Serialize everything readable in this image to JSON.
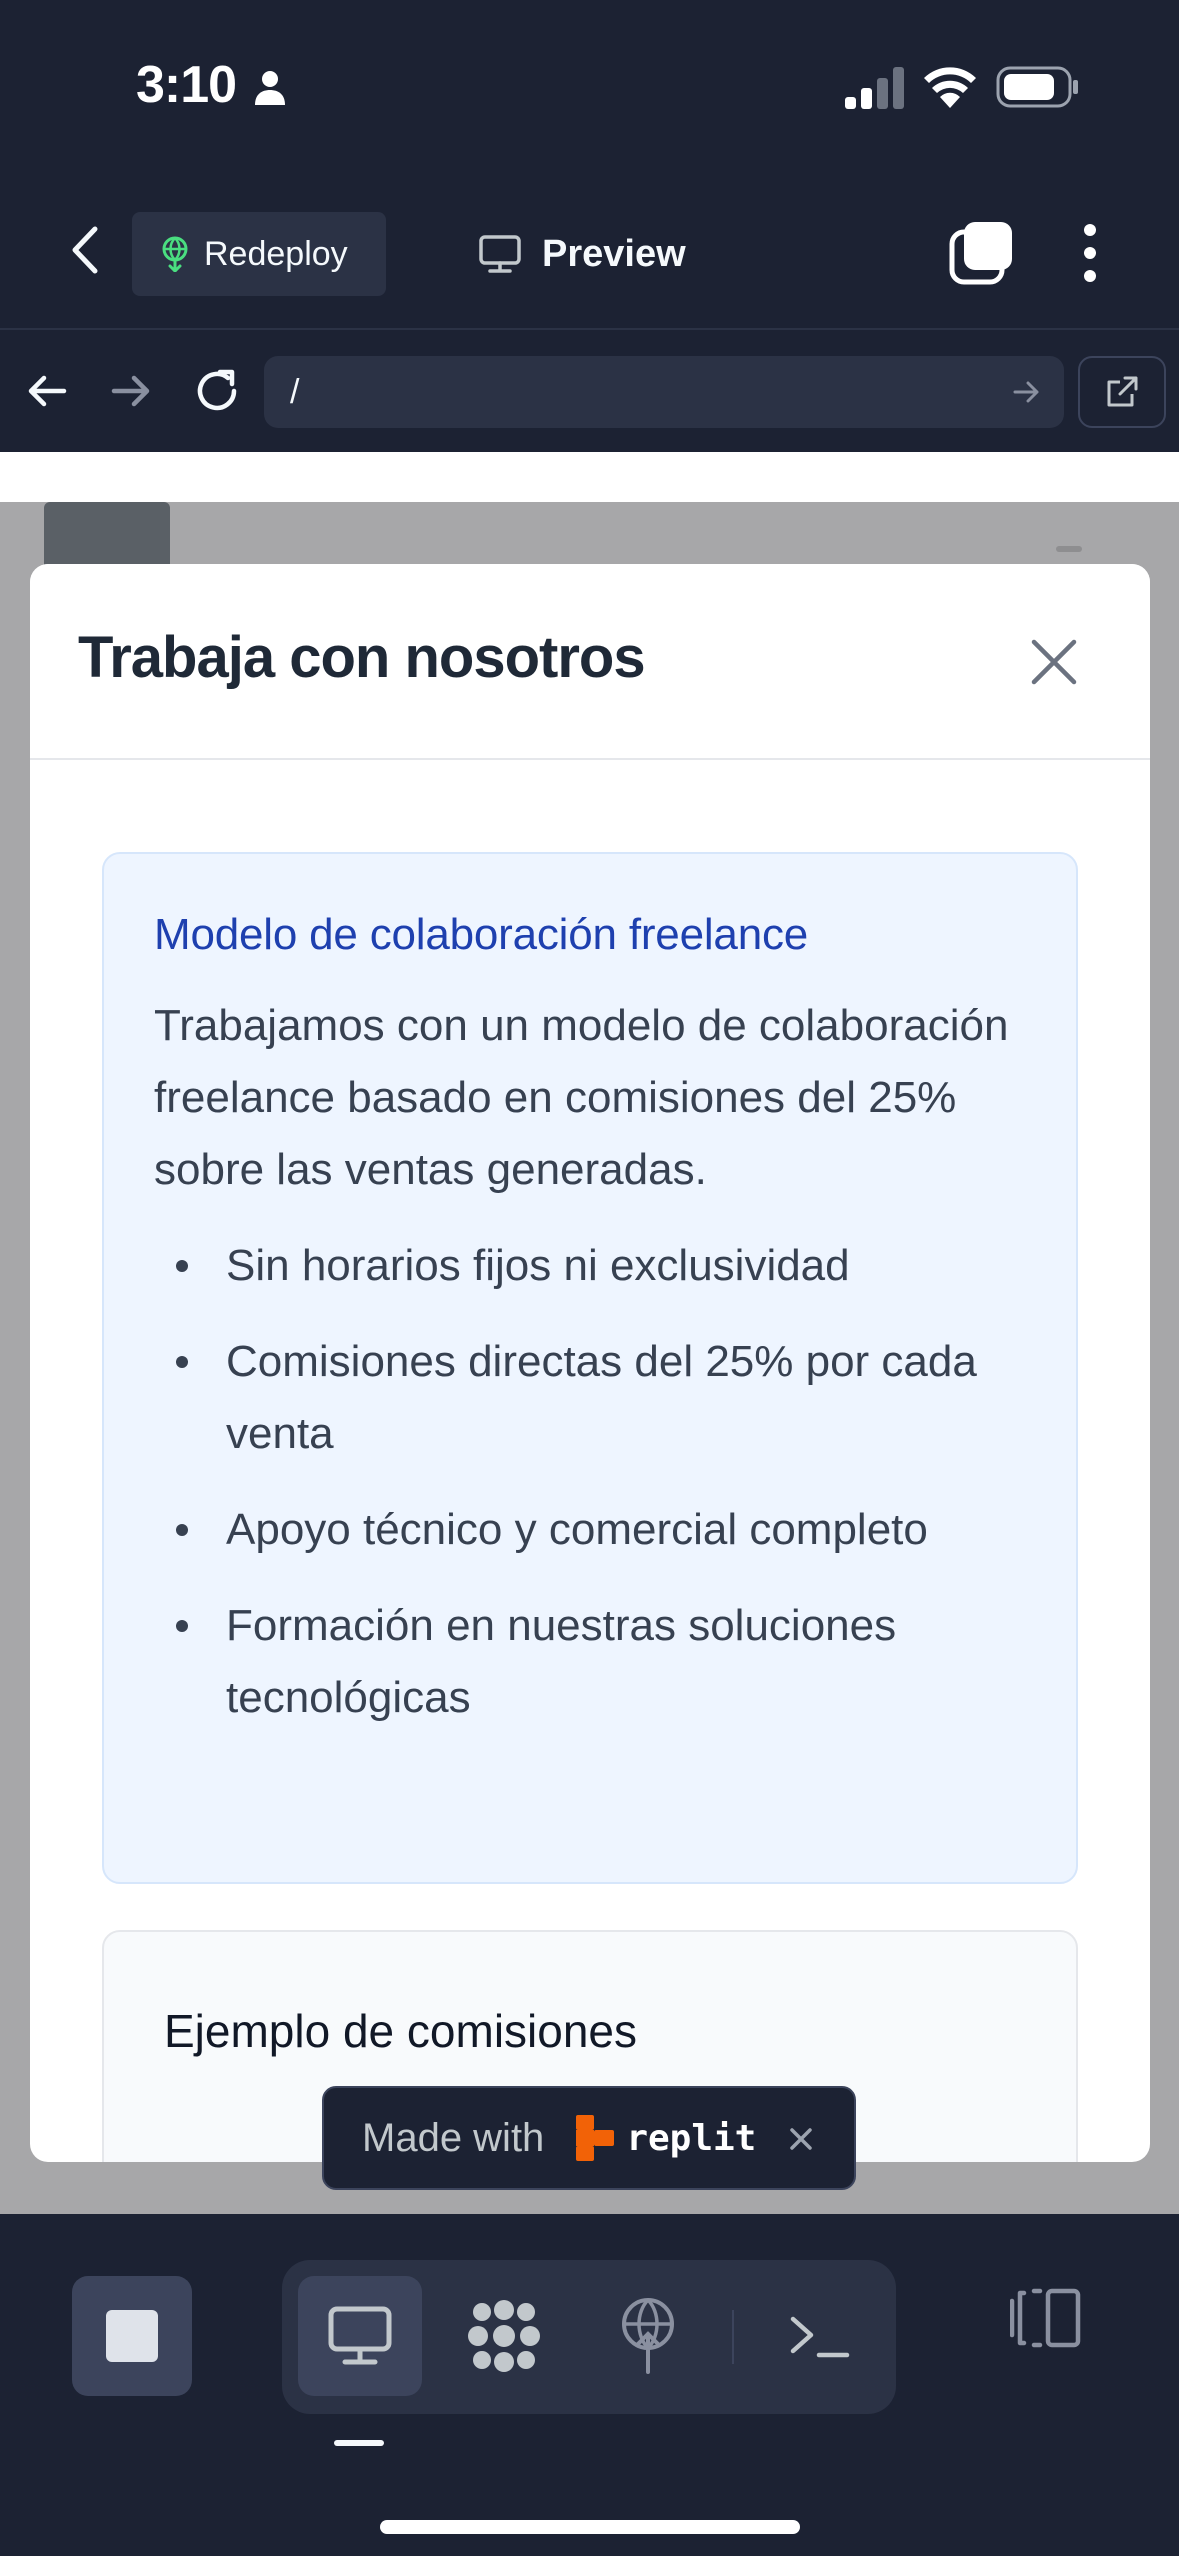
{
  "status_bar": {
    "time": "3:10",
    "icons": [
      "person-icon",
      "signal-icon",
      "wifi-icon",
      "battery-icon"
    ]
  },
  "app_bar": {
    "back_icon": "chevron-left-icon",
    "redeploy_label": "Redeploy",
    "redeploy_icon": "deploy-icon",
    "preview_label": "Preview",
    "preview_icon": "monitor-icon",
    "tabs_icon": "tabs-icon",
    "more_icon": "more-vertical-icon"
  },
  "address_bar": {
    "url": "/",
    "icons": [
      "arrow-left-icon",
      "arrow-right-icon",
      "reload-icon",
      "open-external-icon"
    ]
  },
  "modal": {
    "title": "Trabaja con nosotros",
    "close_icon": "close-icon",
    "info_card": {
      "heading": "Modelo de colaboración freelance",
      "paragraph": "Trabajamos con un modelo de colaboración freelance basado en comisiones del 25% sobre las ventas generadas.",
      "bullets": [
        "Sin horarios fijos ni exclusividad",
        "Comisiones directas del 25% por cada venta",
        "Apoyo técnico y comercial completo",
        "Formación en nuestras soluciones tecnológicas"
      ]
    },
    "example_card": {
      "heading": "Ejemplo de comisiones"
    }
  },
  "badge": {
    "made_with": "Made with",
    "brand": "replit",
    "close_icon": "close-icon"
  },
  "bottom_bar": {
    "tools": [
      "monitor-icon",
      "agent-icon",
      "deploy-icon",
      "terminal-icon"
    ],
    "stop_icon": "stop-icon",
    "panels_icon": "panels-icon"
  },
  "colors": {
    "chrome_bg": "#1c2233",
    "chrome_surface": "#2b3245",
    "card_bg": "#eef5ff",
    "heading_blue": "#1e40af",
    "replit_orange": "#f26207"
  }
}
